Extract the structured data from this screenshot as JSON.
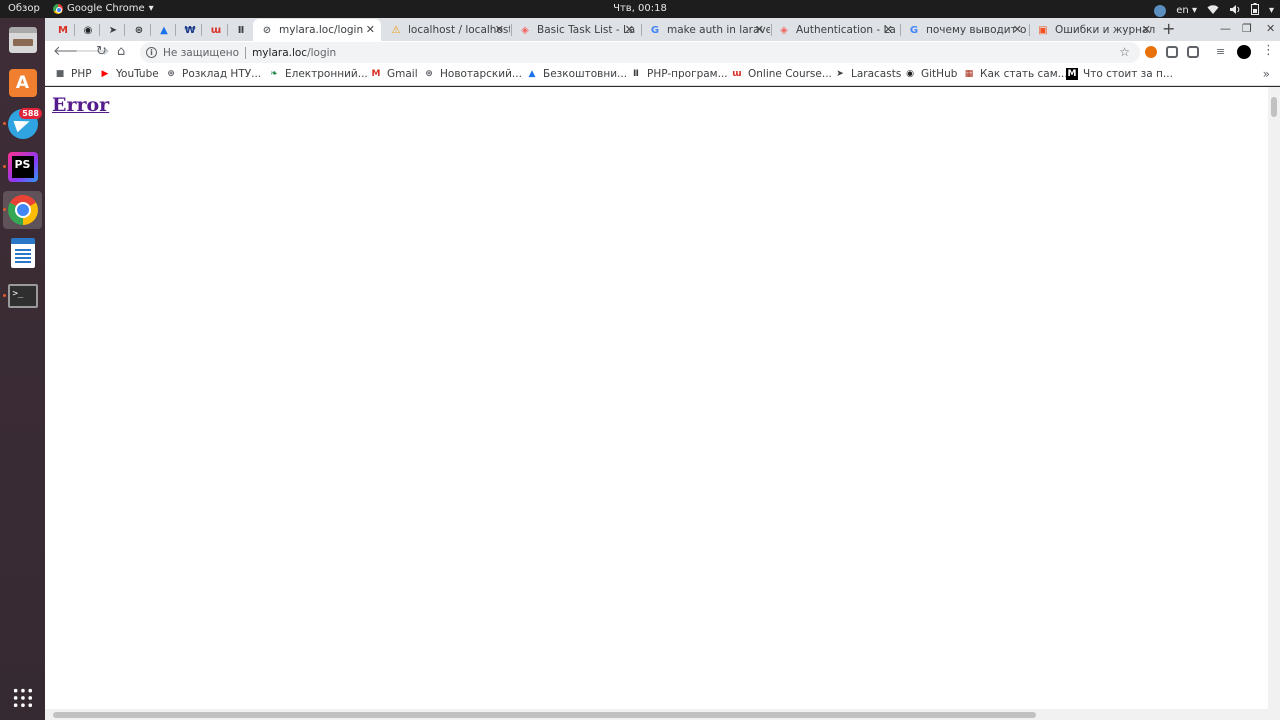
{
  "topbar": {
    "activities": "Обзор",
    "app_name": "Google Chrome",
    "clock": "Чтв, 00:18",
    "keyboard_layout": "en"
  },
  "launcher": {
    "items": [
      {
        "name": "files",
        "icon": "file-cabinet-icon"
      },
      {
        "name": "software-center",
        "icon": "shopping-bag-icon",
        "glyph": "A"
      },
      {
        "name": "telegram",
        "icon": "telegram-icon",
        "badge": "588"
      },
      {
        "name": "phpstorm",
        "icon": "phpstorm-icon",
        "glyph": "PS"
      },
      {
        "name": "chrome",
        "icon": "chrome-icon"
      },
      {
        "name": "writer",
        "icon": "document-icon"
      },
      {
        "name": "terminal",
        "icon": "terminal-icon",
        "glyph": ">_"
      },
      {
        "name": "show-apps",
        "icon": "app-grid-icon"
      }
    ]
  },
  "tabs": [
    {
      "title": "",
      "favicon": "M",
      "color": "#d93025"
    },
    {
      "title": "",
      "favicon": "◉",
      "color": "#202124"
    },
    {
      "title": "",
      "favicon": "➤",
      "color": "#3c4043"
    },
    {
      "title": "",
      "favicon": "⊛",
      "color": "#3c4043"
    },
    {
      "title": "",
      "favicon": "▲",
      "color": "#1a73e8"
    },
    {
      "title": "",
      "favicon": "₩",
      "color": "#1a3c8a"
    },
    {
      "title": "",
      "favicon": "ɯ",
      "color": "#d93025"
    },
    {
      "title": "",
      "favicon": "Ⅱ",
      "color": "#3c4043"
    },
    {
      "title": "mylara.loc/login",
      "favicon": "⊘",
      "color": "#5f6368",
      "active": true
    },
    {
      "title": "localhost / localhost",
      "favicon": "⚠",
      "color": "#f29900"
    },
    {
      "title": "Basic Task List - La",
      "favicon": "◈",
      "color": "#f4645f"
    },
    {
      "title": "make auth in larave",
      "favicon": "G",
      "color": "#4285f4"
    },
    {
      "title": "Authentication - La",
      "favicon": "◈",
      "color": "#f4645f"
    },
    {
      "title": "почему выводит о",
      "favicon": "G",
      "color": "#4285f4"
    },
    {
      "title": "Ошибки и журнал",
      "favicon": "▣",
      "color": "#f4511e"
    }
  ],
  "toolbar": {
    "security_label": "Не защищено",
    "url_host": "mylara.loc",
    "url_path": "/login"
  },
  "bookmarks": [
    {
      "label": "PHP",
      "icon": "folder-icon",
      "glyph": "■",
      "color": "#5f6368"
    },
    {
      "label": "YouTube",
      "icon": "youtube-icon",
      "glyph": "▶",
      "color": "#ff0000"
    },
    {
      "label": "Розклад НТУ...",
      "icon": "globe-icon",
      "glyph": "⊛",
      "color": "#5f6368"
    },
    {
      "label": "Електронний...",
      "icon": "leaf-icon",
      "glyph": "❧",
      "color": "#188038"
    },
    {
      "label": "Gmail",
      "icon": "gmail-icon",
      "glyph": "M",
      "color": "#d93025"
    },
    {
      "label": "Новотарский...",
      "icon": "globe-icon",
      "glyph": "⊛",
      "color": "#5f6368"
    },
    {
      "label": "Безкоштовни...",
      "icon": "course-icon",
      "glyph": "▲",
      "color": "#1a73e8"
    },
    {
      "label": "PHP-програм...",
      "icon": "person-icon",
      "glyph": "Ⅱ",
      "color": "#3c4043"
    },
    {
      "label": "Online Course...",
      "icon": "course-icon",
      "glyph": "ɯ",
      "color": "#d93025"
    },
    {
      "label": "Laracasts",
      "icon": "laracasts-icon",
      "glyph": "➤",
      "color": "#3c4043"
    },
    {
      "label": "GitHub",
      "icon": "github-icon",
      "glyph": "◉",
      "color": "#202124"
    },
    {
      "label": "Как стать сам...",
      "icon": "article-icon",
      "glyph": "▦",
      "color": "#a52714"
    },
    {
      "label": "Что стоит за п...",
      "icon": "medium-icon",
      "glyph": "M",
      "color": "#000000"
    }
  ],
  "page": {
    "heading": "Error"
  }
}
